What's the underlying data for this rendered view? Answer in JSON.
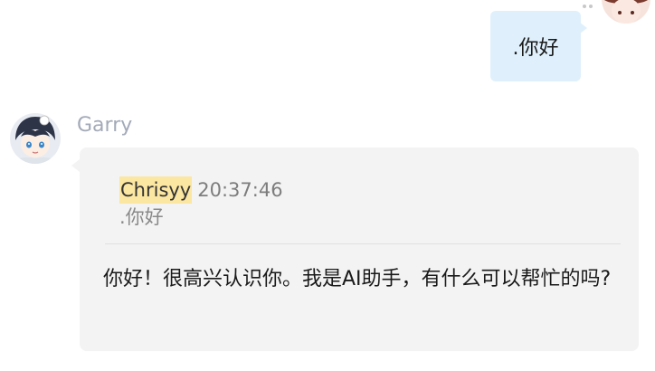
{
  "outgoing": {
    "text": ".你好",
    "avatar_icon": "anime-avatar-icon",
    "bubble_color": "#dff0fc"
  },
  "incoming": {
    "sender": "Garry",
    "avatar_icon": "anime-boy-avatar-icon",
    "bubble_color": "#f3f3f3",
    "quote": {
      "author": "Chrisyy",
      "time": "20:37:46",
      "text": ".你好",
      "highlight_color": "#fbe6a2"
    },
    "reply": " 你好！很高兴认识你。我是AI助手，有什么可以帮忙的吗?"
  }
}
